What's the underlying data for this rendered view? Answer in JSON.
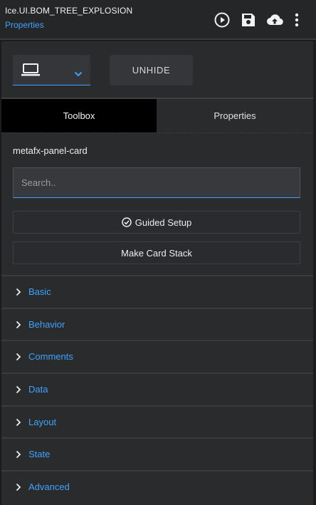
{
  "header": {
    "title": "Ice.UI.BOM_TREE_EXPLOSION",
    "subtitle": "Properties",
    "icons": [
      "play-circle-icon",
      "save-icon",
      "cloud-upload-icon",
      "more-vertical-icon"
    ]
  },
  "toolbar": {
    "device_icon": "laptop-icon",
    "unhide_label": "UNHIDE"
  },
  "tabs": [
    {
      "label": "Toolbox",
      "active": true
    },
    {
      "label": "Properties",
      "active": false
    }
  ],
  "component_name": "metafx-panel-card",
  "search": {
    "placeholder": "Search..",
    "value": ""
  },
  "buttons": {
    "guided_setup": "Guided Setup",
    "make_card_stack": "Make Card Stack"
  },
  "sections": [
    {
      "label": "Basic"
    },
    {
      "label": "Behavior"
    },
    {
      "label": "Comments"
    },
    {
      "label": "Data"
    },
    {
      "label": "Layout"
    },
    {
      "label": "State"
    },
    {
      "label": "Advanced"
    }
  ],
  "colors": {
    "accent": "#3ea3ff",
    "background": "#2a2b2d",
    "active_tab": "#000000"
  }
}
